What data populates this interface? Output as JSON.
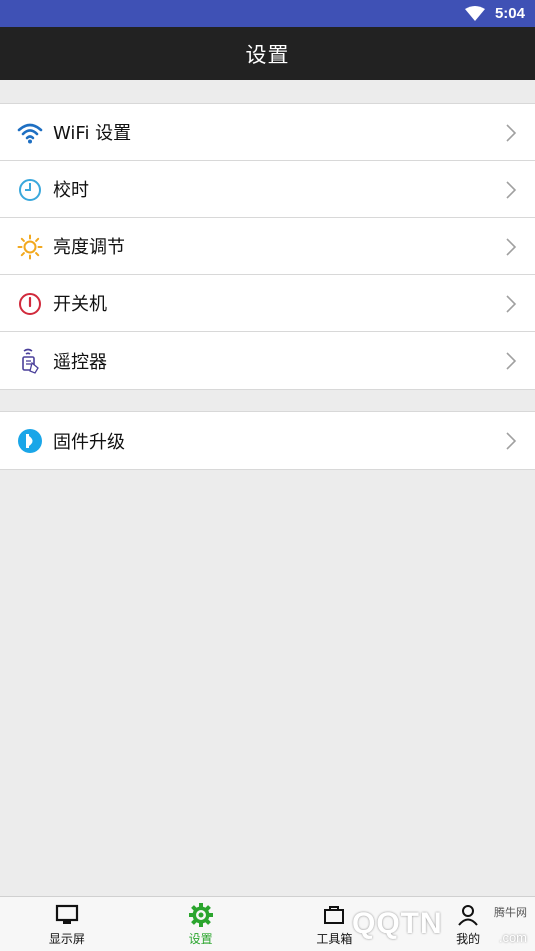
{
  "status_bar": {
    "time": "5:04",
    "wifi_icon": "wifi-icon",
    "color": "#3f51b5"
  },
  "app_bar": {
    "title": "设置"
  },
  "settings_group_1": [
    {
      "label": "WiFi 设置",
      "icon": "wifi-icon",
      "color": "#1e6fc2"
    },
    {
      "label": "校时",
      "icon": "clock-icon",
      "color": "#3aa8dc"
    },
    {
      "label": "亮度调节",
      "icon": "brightness-icon",
      "color": "#f2a81d"
    },
    {
      "label": "开关机",
      "icon": "power-icon",
      "color": "#d12a3c"
    },
    {
      "label": "遥控器",
      "icon": "remote-icon",
      "color": "#4a3f9a"
    }
  ],
  "settings_group_2": [
    {
      "label": "固件升级",
      "icon": "firmware-icon",
      "color": "#1aa6e8"
    }
  ],
  "tab_bar": {
    "tabs": [
      {
        "label": "显示屏",
        "icon": "monitor-icon",
        "active": false
      },
      {
        "label": "设置",
        "icon": "gear-icon",
        "active": true
      },
      {
        "label": "工具箱",
        "icon": "toolbox-icon",
        "active": false
      },
      {
        "label": "我的",
        "icon": "user-icon",
        "active": false
      }
    ],
    "active_color": "#2ba52e"
  },
  "watermark": {
    "brand": "QQTN",
    "small_text": "腾牛网",
    "domain": ".com"
  }
}
